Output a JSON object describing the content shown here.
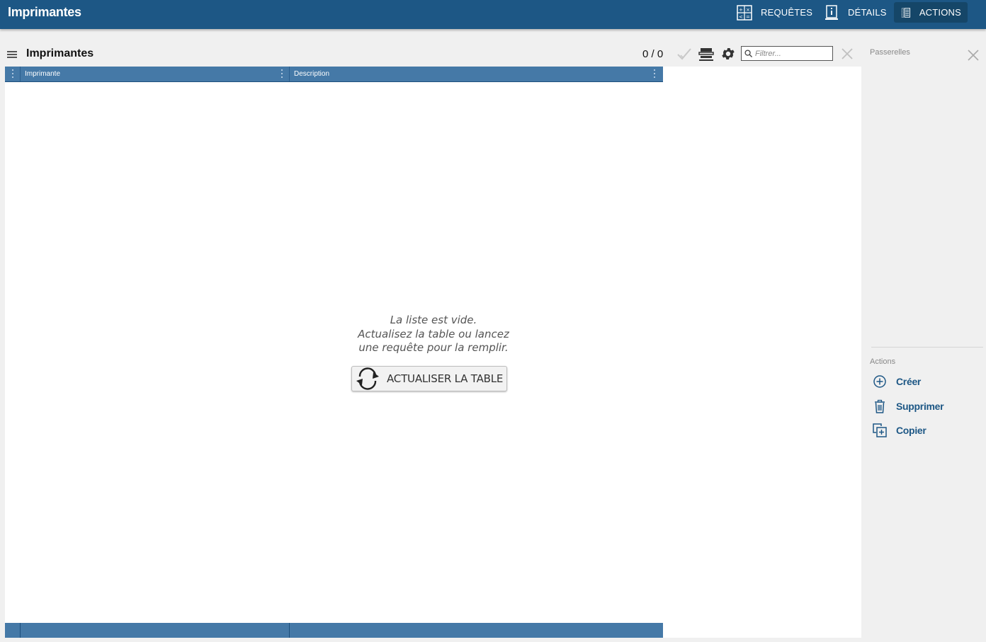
{
  "app": {
    "title": "Imprimantes"
  },
  "nav": {
    "requetes": {
      "label": "REQUÊTES",
      "icon": "query-icon"
    },
    "details": {
      "label": "DÉTAILS",
      "icon": "details-icon"
    },
    "actions": {
      "label": "ACTIONS",
      "icon": "actions-icon",
      "active": true
    }
  },
  "list": {
    "title": "Imprimantes",
    "counter": "0 / 0",
    "filter_placeholder": "Filtrer...",
    "columns": [
      {
        "label": "Imprimante"
      },
      {
        "label": "Description"
      }
    ],
    "empty_message": {
      "line1": "La liste est vide.",
      "line2": "Actualisez la table ou lancez",
      "line3": "une requête pour la remplir."
    },
    "refresh_label": "ACTUALISER LA TABLE"
  },
  "side": {
    "passerelles_label": "Passerelles",
    "actions_label": "Actions",
    "actions": [
      {
        "label": "Créer",
        "icon": "plus-circle-icon"
      },
      {
        "label": "Supprimer",
        "icon": "trash-icon"
      },
      {
        "label": "Copier",
        "icon": "copy-icon"
      }
    ]
  },
  "colors": {
    "topbar": "#1d5785",
    "nav_active": "#154668",
    "table_header": "#4579a7",
    "action_text": "#1d5785"
  }
}
